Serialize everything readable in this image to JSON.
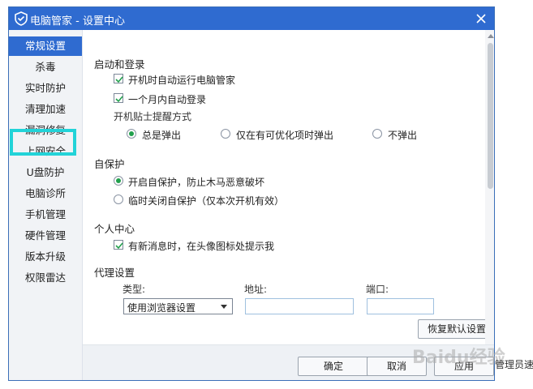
{
  "window": {
    "title": "电脑管家 - 设置中心",
    "title_logo_icon": "shield-logo-icon",
    "close_icon": "close-icon"
  },
  "colors": {
    "titlebar": "#2f6bd0",
    "accent_check": "#21a04c",
    "highlight": "#22d3d8"
  },
  "sidebar": {
    "items": [
      {
        "label": "常规设置",
        "active": true
      },
      {
        "label": "杀毒"
      },
      {
        "label": "实时防护"
      },
      {
        "label": "清理加速"
      },
      {
        "label": "漏洞修复"
      },
      {
        "label": "上网安全"
      },
      {
        "label": "U盘防护"
      },
      {
        "label": "电脑诊所"
      },
      {
        "label": "手机管理"
      },
      {
        "label": "硬件管理"
      },
      {
        "label": "版本升级"
      },
      {
        "label": "权限雷达"
      }
    ]
  },
  "sections": {
    "startup": {
      "title": "启动和登录",
      "auto_run": {
        "label": "开机时自动运行电脑管家",
        "checked": true
      },
      "auto_login": {
        "label": "一个月内自动登录",
        "checked": true
      },
      "tips_mode_title": "开机贴士提醒方式",
      "tips_options": [
        {
          "label": "总是弹出",
          "selected": true
        },
        {
          "label": "仅在有可优化项时弹出",
          "selected": false
        },
        {
          "label": "不弹出",
          "selected": false
        }
      ]
    },
    "self_protect": {
      "title": "自保护",
      "options": [
        {
          "label": "开启自保护，防止木马恶意破坏",
          "selected": true
        },
        {
          "label": "临时关闭自保护（仅本次开机有效）",
          "selected": false
        }
      ]
    },
    "personal": {
      "title": "个人中心",
      "notify": {
        "label": "有新消息时，在头像图标处提示我",
        "checked": true
      }
    },
    "proxy": {
      "title": "代理设置",
      "type_label": "类型:",
      "type_value": "使用浏览器设置",
      "address_label": "地址:",
      "port_label": "端口:",
      "address_value": "",
      "port_value": "",
      "restore_button": "恢复默认设置"
    }
  },
  "footer": {
    "ok": "确定",
    "cancel": "取消",
    "apply": "应用"
  },
  "overlay": {
    "watermark": "Baidu经验",
    "outside_text": "管理员速"
  }
}
